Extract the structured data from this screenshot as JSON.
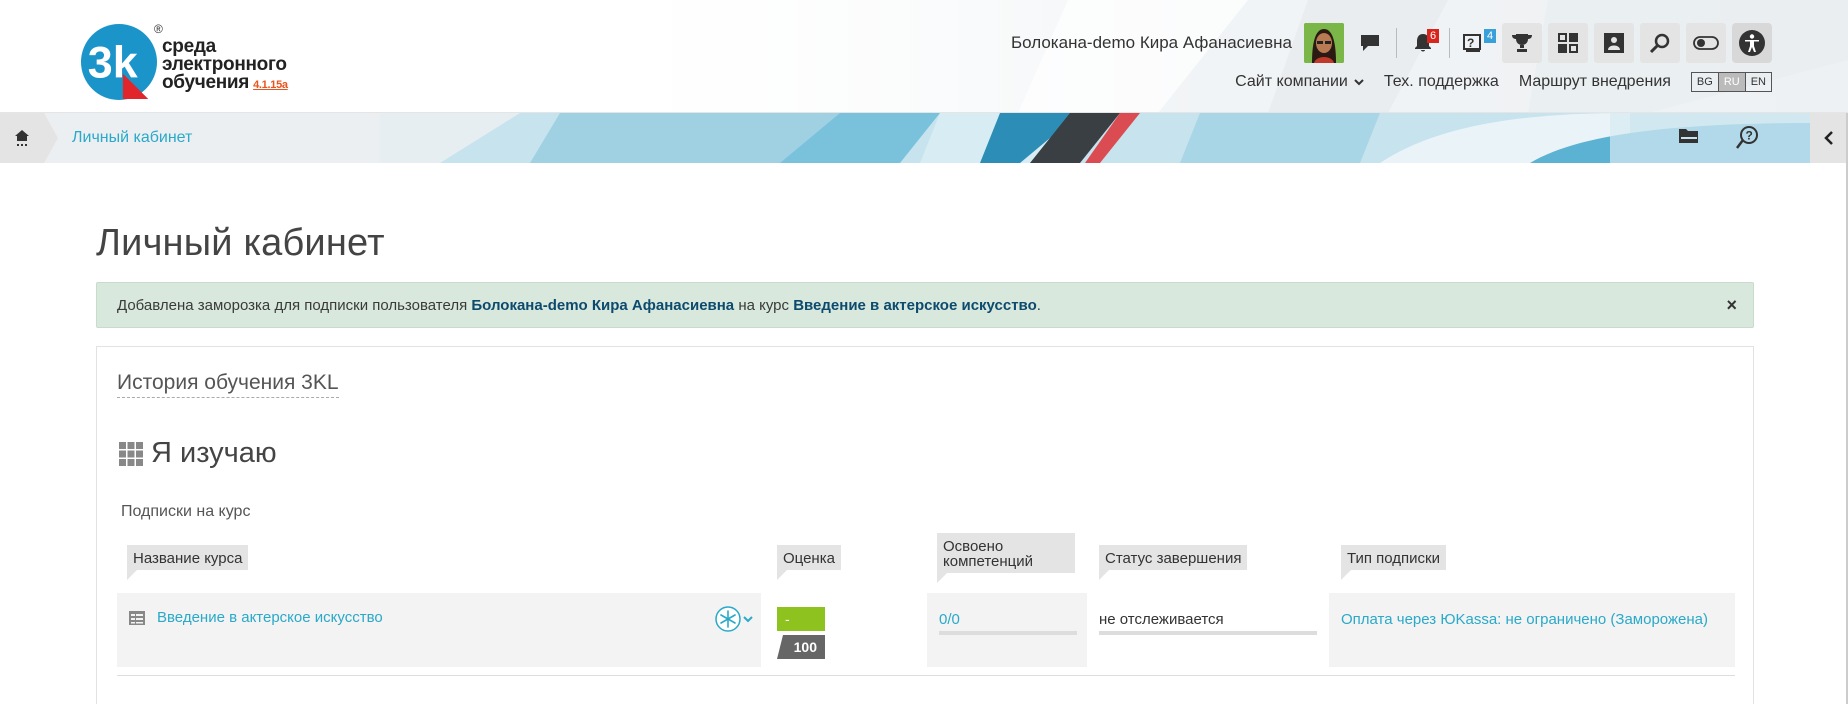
{
  "header": {
    "logo": {
      "badge": "3k",
      "reg": "®",
      "lines": [
        "среда",
        "электронного",
        "обучения"
      ],
      "version": "4.1.15a"
    },
    "user_name": "Болокана-demo Кира Афанасиевна",
    "icons": {
      "messages": "chat-icon",
      "notifications": "bell-icon",
      "notifications_count": "6",
      "questions": "question-icon",
      "questions_count": "4",
      "achievements": "trophy-icon",
      "dashboard": "grid-icon",
      "portfolio": "portfolio-icon",
      "search": "search-icon",
      "toggle": "toggle-icon",
      "accessibility": "accessibility-icon"
    },
    "nav": {
      "company_site": "Сайт компании",
      "support": "Тех. поддержка",
      "route": "Маршрут внедрения"
    },
    "languages": [
      "BG",
      "RU",
      "EN"
    ],
    "active_language": "RU"
  },
  "breadcrumb": {
    "current": "Личный кабинет"
  },
  "page": {
    "title": "Личный кабинет",
    "alert": {
      "prefix": "Добавлена заморозка для подписки пользователя ",
      "user": "Болокана-demo Кира Афанасиевна",
      "middle": " на курс ",
      "course": "Введение в актерское искусство",
      "suffix": ".",
      "close": "×"
    },
    "card": {
      "title": "История обучения 3KL",
      "section_title": "Я изучаю",
      "subtitle": "Подписки на курс",
      "columns": {
        "name": "Название курса",
        "grade": "Оценка",
        "competencies_1": "Освоено",
        "competencies_2": "компетенций",
        "status": "Статус завершения",
        "type": "Тип подписки"
      },
      "rows": [
        {
          "name": "Введение в актерское искусство",
          "grade_value": "-",
          "grade_max": "100",
          "competencies": "0/0",
          "status": "не отслеживается",
          "subscription": "Оплата через ЮKassa: не ограничено (Заморожена)"
        }
      ]
    }
  },
  "colors": {
    "accent": "#2aa9c9",
    "alert_bg": "#d9e8dd",
    "grade_green": "#8dc21f",
    "brand_blue": "#1b95c9",
    "brand_red": "#e0262b"
  }
}
